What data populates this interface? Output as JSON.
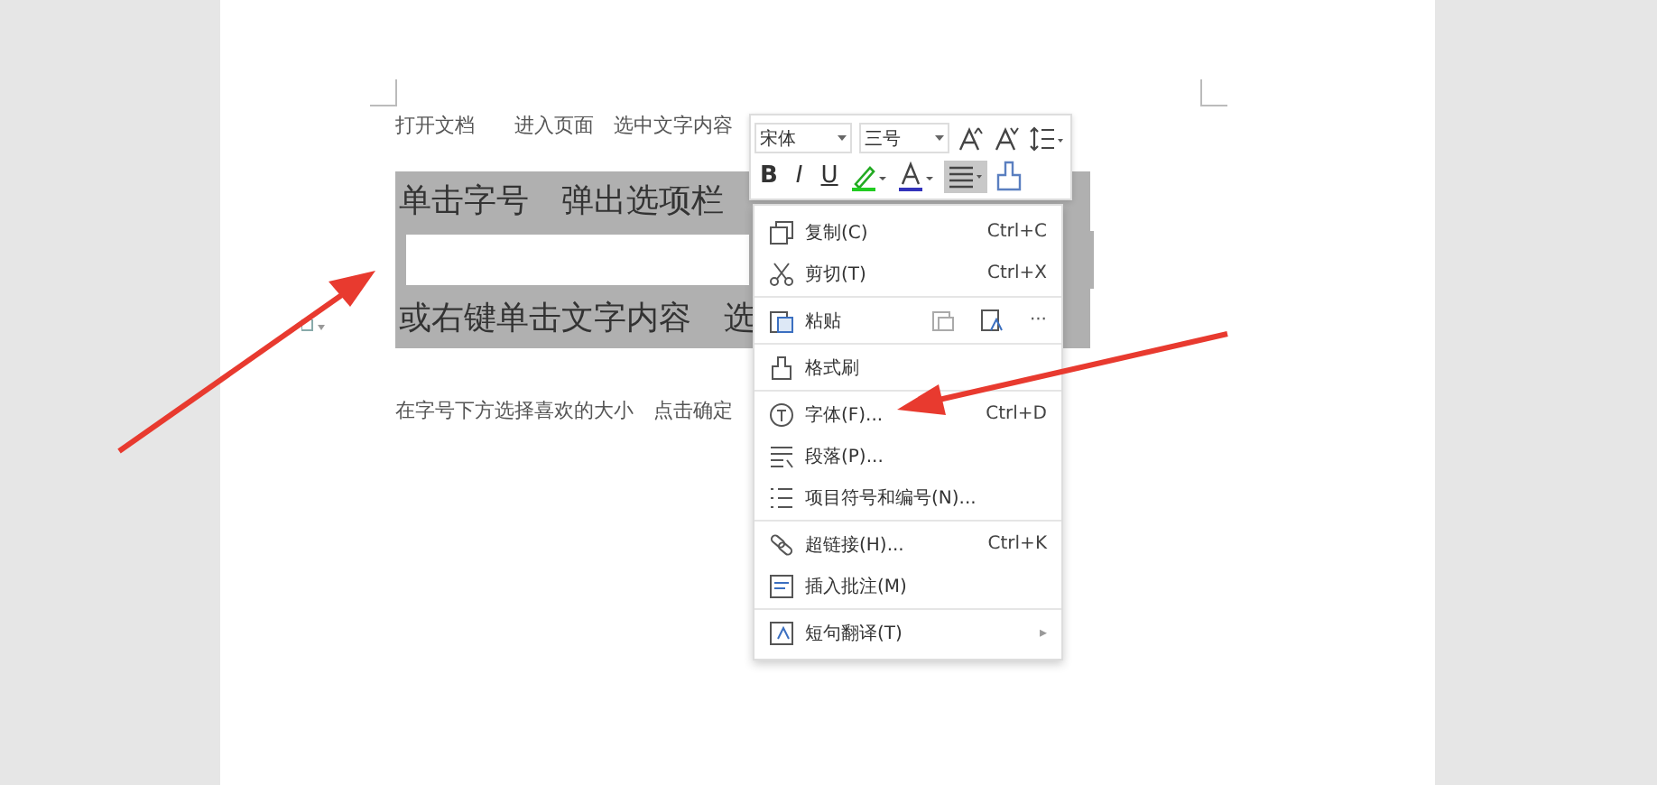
{
  "document": {
    "lines": [
      {
        "kind": "small",
        "text": "打开文档　　进入页面　选中文字内容"
      },
      {
        "kind": "selected",
        "text": "单击字号　弹出选项栏"
      },
      {
        "kind": "selected_blank"
      },
      {
        "kind": "selected",
        "text": "或右键单击文字内容　选"
      },
      {
        "kind": "small",
        "text": "在字号下方选择喜欢的大小　点击确定"
      }
    ]
  },
  "toolbar": {
    "font": "宋体",
    "size": "三号",
    "row1": [
      {
        "kind": "grow"
      },
      {
        "kind": "shrink"
      },
      {
        "kind": "spacing"
      }
    ],
    "row2": [
      {
        "kind": "bold",
        "text": "B",
        "selected": false
      },
      {
        "kind": "italic",
        "text": "I",
        "selected": false
      },
      {
        "kind": "underline",
        "text": "U",
        "selected": false
      },
      {
        "kind": "highlight",
        "selected": false
      },
      {
        "kind": "color",
        "selected": false
      },
      {
        "kind": "align",
        "selected": true
      },
      {
        "kind": "brush",
        "selected": false
      }
    ]
  },
  "context_menu": {
    "items": [
      {
        "kind": "copy",
        "label": "复制(C)",
        "shortcut": "Ctrl+C",
        "separator_before": false
      },
      {
        "kind": "cut",
        "label": "剪切(T)",
        "shortcut": "Ctrl+X",
        "separator_before": false
      },
      {
        "kind": "paste",
        "label": "粘贴",
        "paste_options": true,
        "more": "···",
        "separator_before": true
      },
      {
        "kind": "brush",
        "label": "格式刷",
        "separator_before": true
      },
      {
        "kind": "font",
        "label": "字体(F)...",
        "shortcut": "Ctrl+D",
        "separator_before": true
      },
      {
        "kind": "paragraph",
        "label": "段落(P)...",
        "separator_before": false
      },
      {
        "kind": "list",
        "label": "项目符号和编号(N)...",
        "separator_before": false
      },
      {
        "kind": "link",
        "label": "超链接(H)...",
        "shortcut": "Ctrl+K",
        "separator_before": true
      },
      {
        "kind": "comment",
        "label": "插入批注(M)",
        "separator_before": false
      },
      {
        "kind": "translate",
        "label": "短句翻译(T)",
        "submenu": "▸",
        "separator_before": true
      }
    ]
  }
}
